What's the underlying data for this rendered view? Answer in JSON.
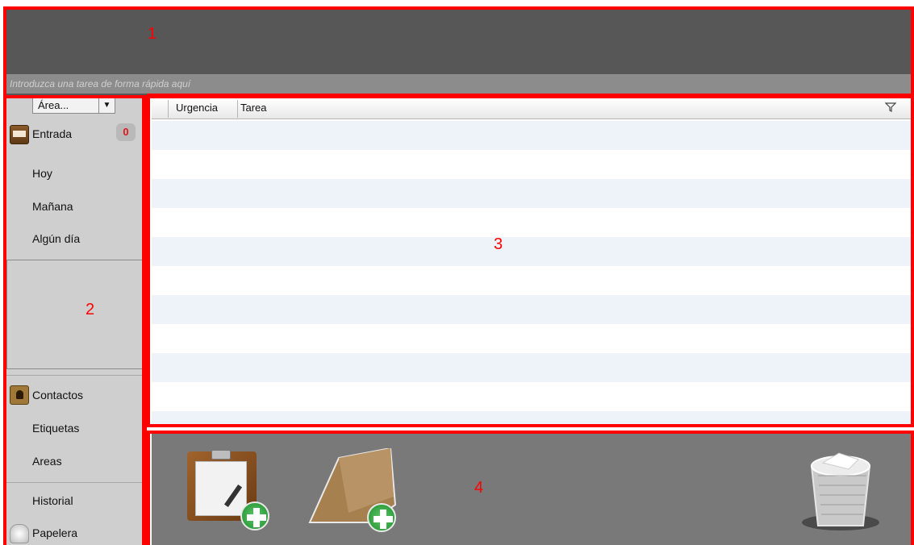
{
  "header": {
    "quick_task_placeholder": "Introduzca una tarea de forma rápida aquí"
  },
  "sidebar": {
    "area_selector": "Área...",
    "inbox": {
      "label": "Entrada",
      "count": "0"
    },
    "items": [
      {
        "label": "Hoy"
      },
      {
        "label": "Mañana"
      },
      {
        "label": "Algún día"
      }
    ],
    "secondary": [
      {
        "label": "Contactos"
      },
      {
        "label": "Etiquetas"
      },
      {
        "label": "Areas"
      }
    ],
    "footer": [
      {
        "label": "Historial"
      },
      {
        "label": "Papelera"
      }
    ]
  },
  "table": {
    "columns": [
      {
        "label": "Urgencia"
      },
      {
        "label": "Tarea"
      }
    ],
    "row_color_alt": "#eef3fa"
  },
  "annotations": {
    "region_1": "1",
    "region_2": "2",
    "region_3": "3",
    "region_4": "4",
    "color": "#ff0000"
  },
  "icons": {
    "inbox": "inbox-tray-icon",
    "contacts": "contacts-book-icon",
    "trash": "trash-bin-icon",
    "filter": "filter-funnel-icon",
    "new_task": "clipboard-add-icon",
    "new_project": "folder-add-icon"
  }
}
